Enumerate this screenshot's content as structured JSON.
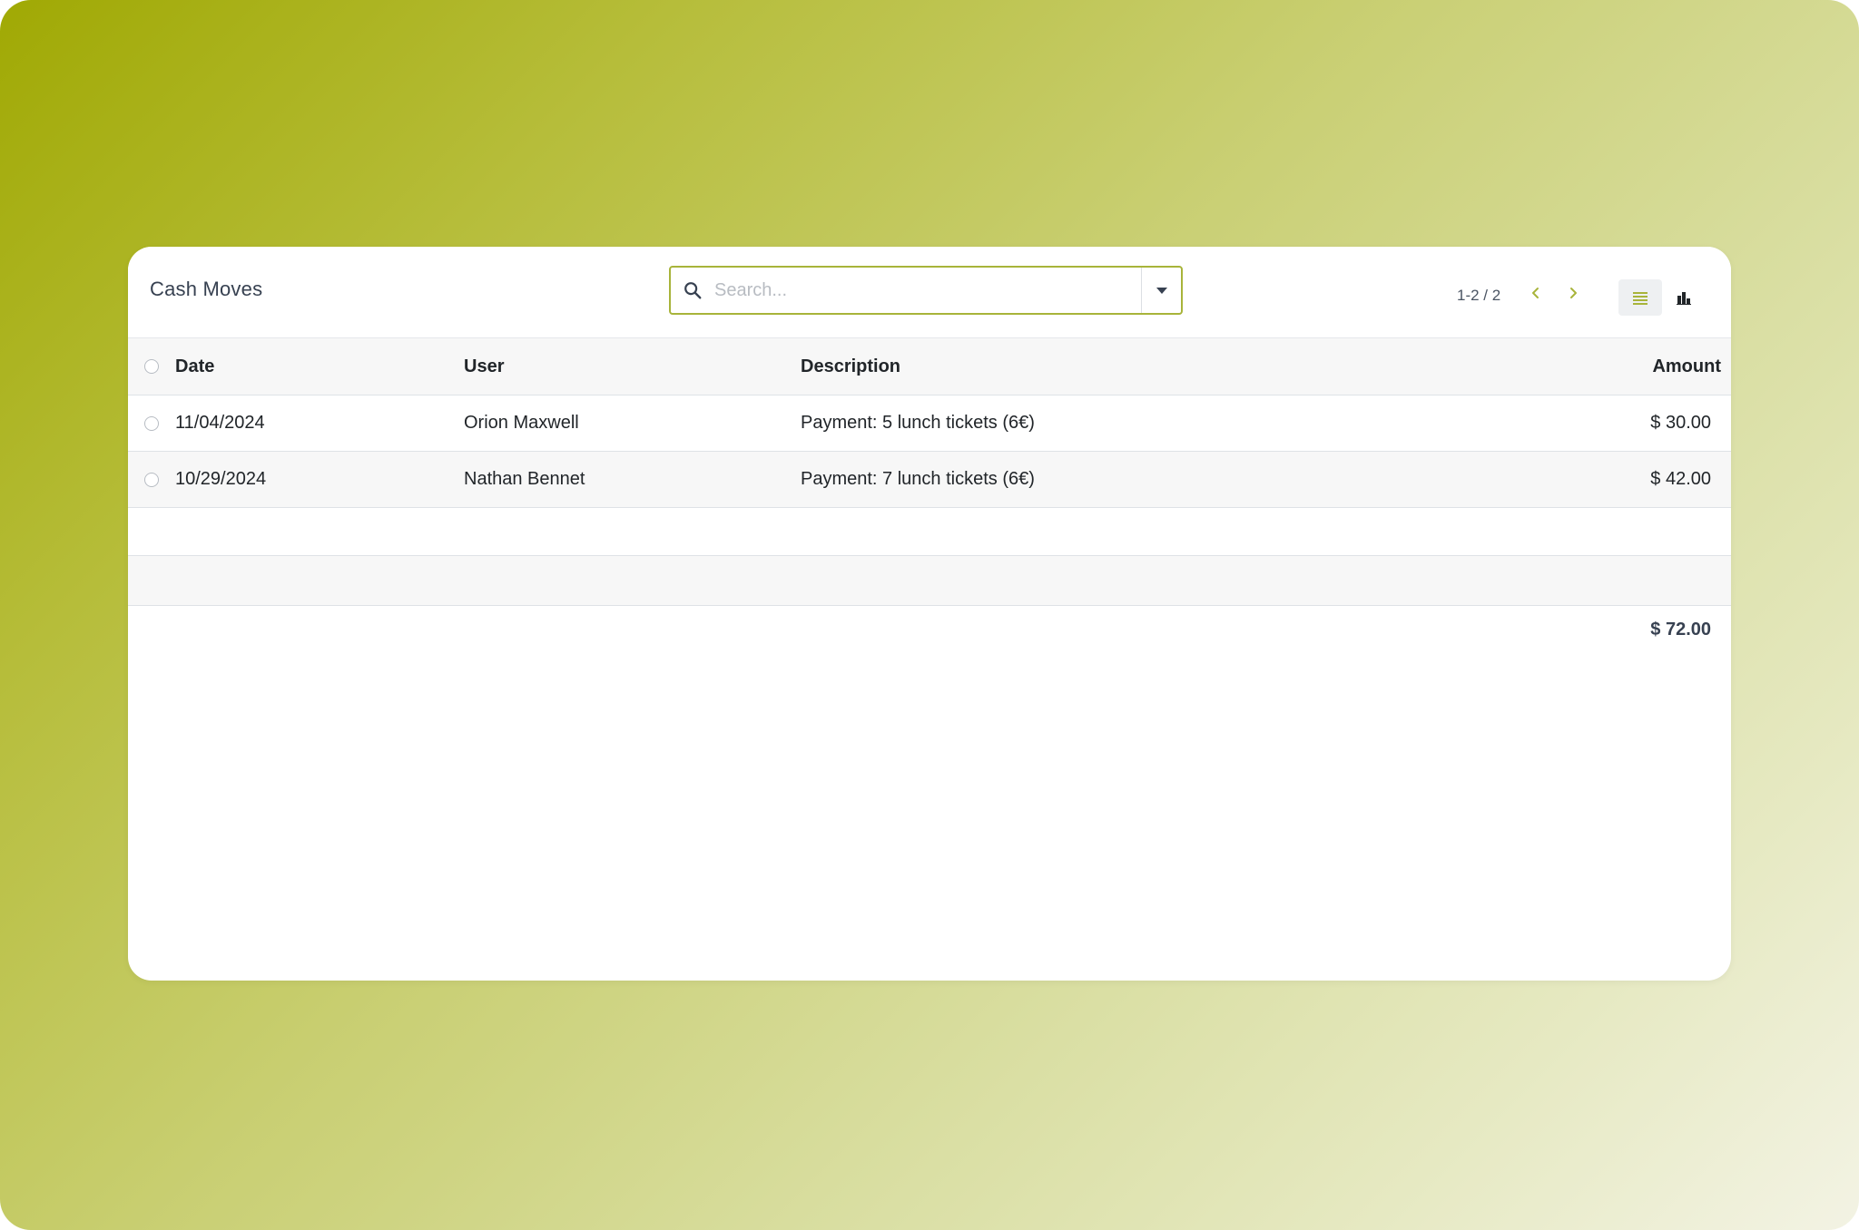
{
  "page": {
    "title": "Cash Moves"
  },
  "search": {
    "placeholder": "Search..."
  },
  "pager": {
    "value": "1-2 / 2"
  },
  "icons": {
    "search": "search-icon",
    "dropdown": "caret-down-icon",
    "prev": "chevron-left-icon",
    "next": "chevron-right-icon",
    "list_view": "list-icon",
    "graph_view": "bar-chart-icon"
  },
  "colors": {
    "accent": "#a8b43a",
    "header_bg": "#f7f7f7"
  },
  "table": {
    "columns": {
      "date": "Date",
      "user": "User",
      "description": "Description",
      "amount": "Amount"
    },
    "rows": [
      {
        "date": "11/04/2024",
        "user": "Orion Maxwell",
        "description": "Payment: 5 lunch tickets (6€)",
        "amount": "$ 30.00"
      },
      {
        "date": "10/29/2024",
        "user": "Nathan Bennet",
        "description": "Payment: 7 lunch tickets (6€)",
        "amount": "$ 42.00"
      }
    ],
    "total": "$ 72.00"
  }
}
